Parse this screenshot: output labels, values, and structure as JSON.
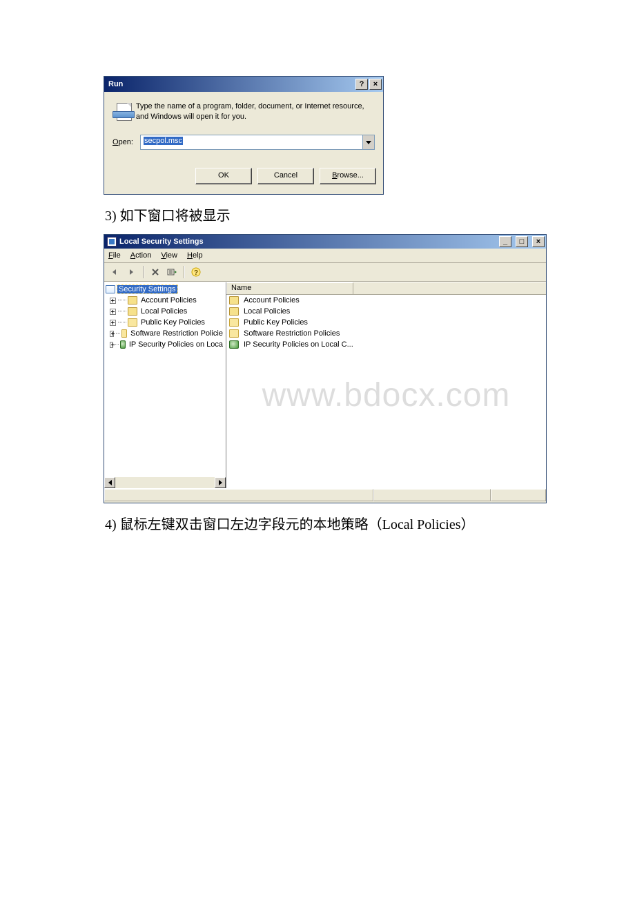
{
  "run": {
    "title": "Run",
    "description": "Type the name of a program, folder, document, or Internet resource, and Windows will open it for you.",
    "open_label": "Open:",
    "open_value": "secpol.msc",
    "ok": "OK",
    "cancel": "Cancel",
    "browse": "Browse..."
  },
  "step3": "3) 如下窗口将被显示",
  "mmc": {
    "title": "Local Security Settings",
    "menus": {
      "file": "File",
      "action": "Action",
      "view": "View",
      "help": "Help"
    },
    "tree": {
      "root": "Security Settings",
      "items": [
        "Account Policies",
        "Local Policies",
        "Public Key Policies",
        "Software Restriction Policie",
        "IP Security Policies on Loca"
      ]
    },
    "list": {
      "header": "Name",
      "rows": [
        "Account Policies",
        "Local Policies",
        "Public Key Policies",
        "Software Restriction Policies",
        "IP Security Policies on Local C..."
      ]
    }
  },
  "watermark": "www.bdocx.com",
  "step4": "4) 鼠标左键双击窗口左边字段元的本地策略（Local Policies）"
}
